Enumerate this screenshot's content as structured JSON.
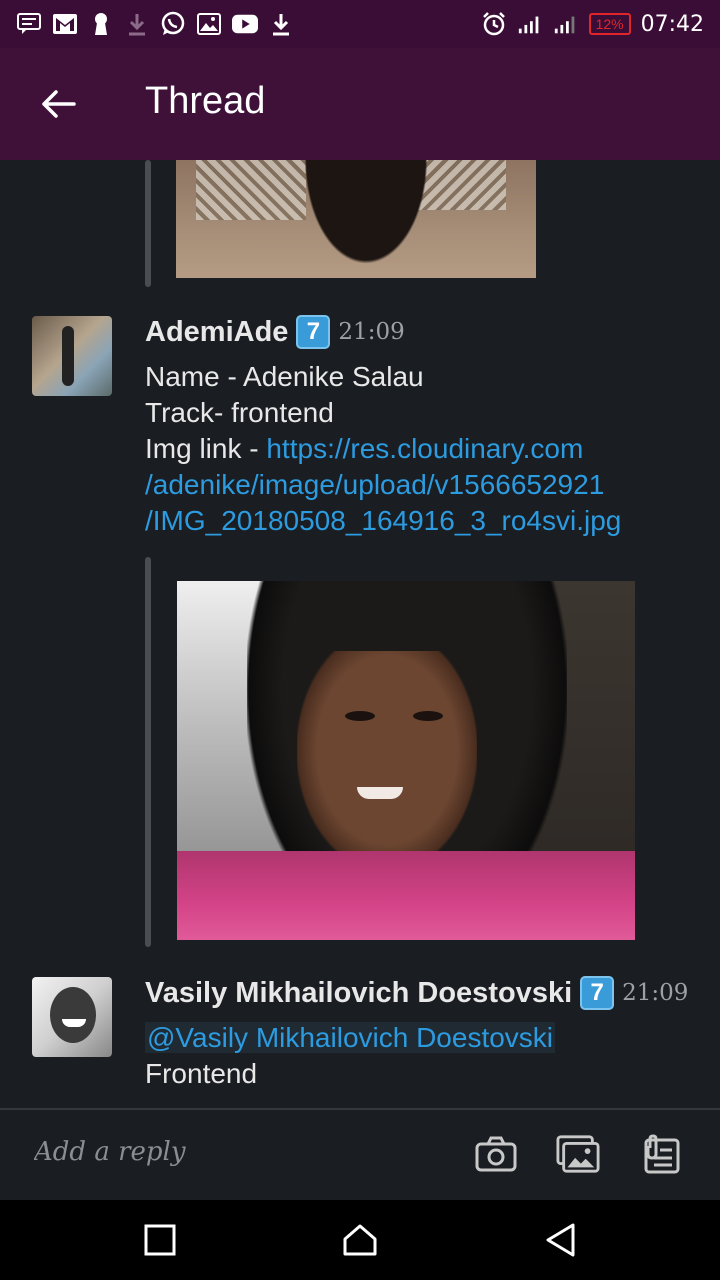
{
  "status_bar": {
    "time": "07:42",
    "battery": "12%",
    "left_icons": [
      "message-icon",
      "gmail-icon",
      "keyhole-icon",
      "download-icon",
      "whatsapp-icon",
      "image-icon",
      "youtube-icon",
      "download-icon"
    ],
    "right_icons": [
      "alarm-icon",
      "signal-icon",
      "signal-icon"
    ]
  },
  "app_bar": {
    "title": "Thread",
    "back_icon": "arrow-left-icon"
  },
  "messages": [
    {
      "username": "AdemiAde",
      "badge": "7",
      "time": "21:09",
      "lines": [
        "Name - Adenike Salau",
        "Track- frontend"
      ],
      "link_prefix": "Img link - ",
      "link_lines": [
        "https://res.cloudinary.com",
        "/adenike/image/upload/v1566652921",
        "/IMG_20180508_164916_3_ro4svi.jpg"
      ]
    },
    {
      "username": "Vasily Mikhailovich Doestovski",
      "badge": "7",
      "time": "21:09",
      "mention": "@Vasily Mikhailovich Doestovski",
      "text": "Frontend"
    }
  ],
  "reply_bar": {
    "placeholder": "Add a reply",
    "icons": [
      "camera-icon",
      "gallery-icon",
      "attachment-icon"
    ]
  },
  "nav_bar": {
    "icons": [
      "recents-icon",
      "home-icon",
      "back-icon"
    ]
  },
  "colors": {
    "app_bar": "#3f1139",
    "status_bar": "#3a0d36",
    "background": "#1a1d21",
    "link": "#2c9be0",
    "badge": "#3a9bd9"
  }
}
